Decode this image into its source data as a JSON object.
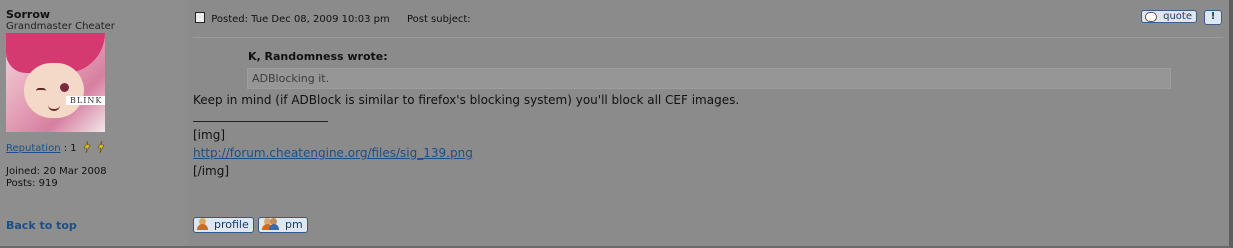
{
  "author": {
    "username": "Sorrow",
    "rank": "Grandmaster Cheater",
    "avatar_text": "BLINK",
    "reputation_label": "Reputation",
    "reputation_value": ": 1",
    "joined": "Joined: 20 Mar 2008",
    "posts": "Posts: 919"
  },
  "post": {
    "posted": "Posted: Tue Dec 08, 2009 10:03 pm",
    "subject": "Post subject:",
    "quote_author": "K, Randomness wrote:",
    "quote_text": "ADBlocking it.",
    "body_line1": "Keep in mind (if ADBlock is similar to firefox's blocking system) you'll block all CEF images.",
    "sig_img_open": "[img]",
    "sig_url": "http://forum.cheatengine.org/files/sig_139.png",
    "sig_img_close": "[/img]"
  },
  "buttons": {
    "quote": "quote",
    "report": "!",
    "profile": "profile",
    "pm": "pm"
  },
  "nav": {
    "back_to_top": "Back to top"
  },
  "colors": {
    "link": "#1b4f86",
    "background": "#8c8c8c"
  }
}
